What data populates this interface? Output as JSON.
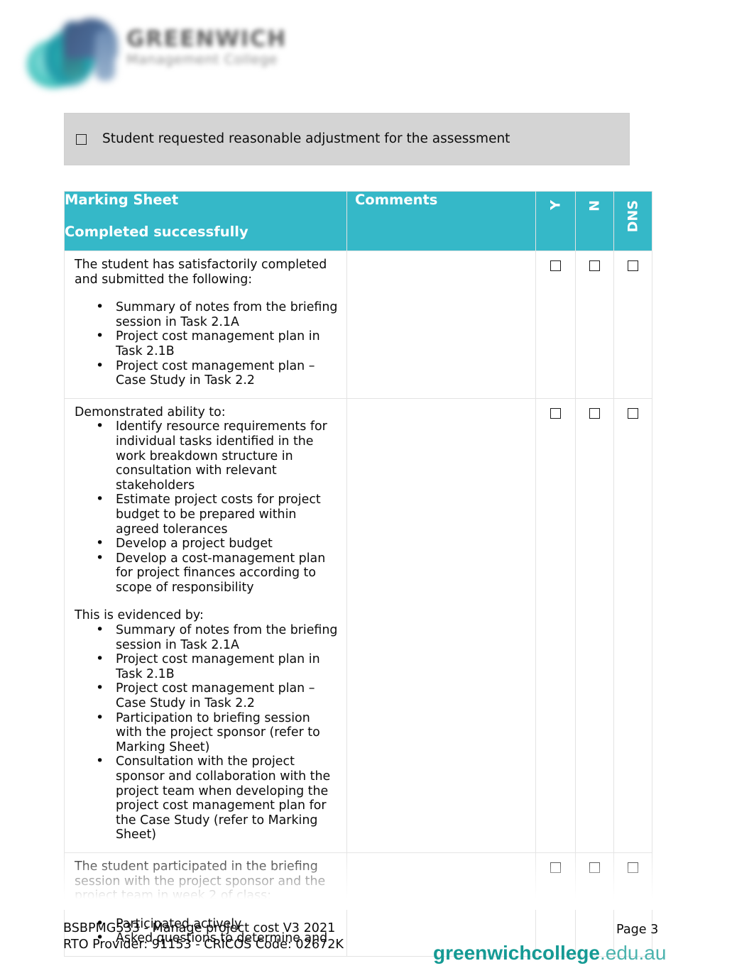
{
  "colors": {
    "teal_header": "#35b8c8",
    "gray_box": "#d4d4d4",
    "url_bold": "#159a94",
    "url_light": "#4bb3ae"
  },
  "header": {
    "logo_icon": "greenwich-swirl-m-logo",
    "wordmark_line1": "GREENWICH",
    "wordmark_line2": "Management College"
  },
  "adjustment_notice": {
    "checkbox_icon": "empty-checkbox-icon",
    "text": "Student requested reasonable adjustment for the assessment"
  },
  "marking_sheet": {
    "columns": {
      "criteria_title_line1": "Marking Sheet",
      "criteria_title_line2": "Completed successfully",
      "comments": "Comments",
      "y": "Y",
      "n": "N",
      "dns": "DNS"
    },
    "rows": [
      {
        "intro": "The student has satisfactorily completed and submitted the following:",
        "bullets": [
          "Summary of notes from the briefing session in Task 2.1A",
          "Project cost management plan in Task 2.1B",
          "Project cost management plan – Case Study in Task 2.2"
        ],
        "sub_intro": "",
        "sub_bullets": [],
        "comments": "",
        "y_checked": false,
        "n_checked": false,
        "dns_checked": false
      },
      {
        "intro": "Demonstrated ability to:",
        "bullets": [
          "Identify resource requirements for individual tasks identified in the work breakdown structure in consultation with relevant stakeholders",
          "Estimate project costs for project budget to be prepared within agreed tolerances",
          "Develop a project budget",
          "Develop a cost-management plan for project finances according to scope of responsibility"
        ],
        "sub_intro": "This is evidenced by:",
        "sub_bullets": [
          "Summary of notes from the briefing session in Task 2.1A",
          "Project cost management plan in Task 2.1B",
          "Project cost management plan – Case Study in Task 2.2",
          "Participation to briefing session with the project sponsor (refer to Marking Sheet)",
          "Consultation with the project sponsor and collaboration with the project team when developing the project cost management plan for the Case Study (refer to Marking Sheet)"
        ],
        "comments": "",
        "y_checked": false,
        "n_checked": false,
        "dns_checked": false
      },
      {
        "intro": "The student participated in the briefing session with the project sponsor and the project team in week 2 of class:",
        "bullets": [
          "Participated actively",
          "Asked questions to determine and"
        ],
        "sub_intro": "",
        "sub_bullets": [],
        "comments": "",
        "y_checked": false,
        "n_checked": false,
        "dns_checked": false
      }
    ]
  },
  "footer": {
    "unit_line": "BSBPMG533 - Manage project cost V3 2021",
    "provider_line": "RTO Provider: 91153  - CRICOS  Code: 02672K",
    "page_label": "Page 3",
    "url_bold": "greenwichcollege",
    "url_light": ".edu.au"
  }
}
